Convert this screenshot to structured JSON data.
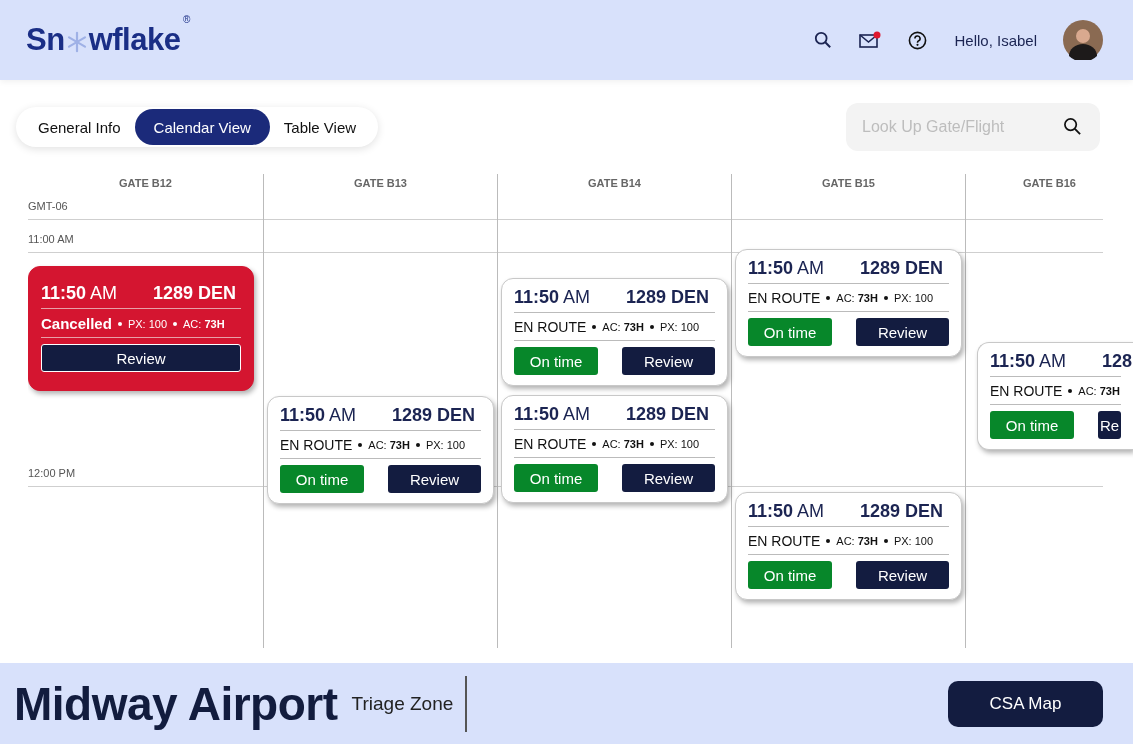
{
  "header": {
    "logo": {
      "before": "Sn",
      "after": "wflake",
      "mark": "®"
    },
    "mail_unread": true,
    "greeting": "Hello, Isabel"
  },
  "tabs": [
    {
      "label": "General Info",
      "selected": false
    },
    {
      "label": "Calendar View",
      "selected": true
    },
    {
      "label": "Table View",
      "selected": false
    }
  ],
  "search": {
    "placeholder": "Look Up Gate/Flight"
  },
  "time_labels": [
    "GMT-06",
    "11:00 AM",
    "12:00 PM"
  ],
  "gates": [
    {
      "label": "GATE B12",
      "cards": [
        {
          "kind": "cancelled",
          "time": "11:50",
          "period": "AM",
          "flight": "1289 DEN",
          "status": "Cancelled",
          "details": [
            "PX: 100",
            "AC: **73H**"
          ],
          "button": "Review"
        }
      ]
    },
    {
      "label": "GATE B13",
      "cards": [
        {
          "kind": "en_route",
          "time": "11:50",
          "period": "AM",
          "flight": "1289 DEN",
          "status": "EN ROUTE",
          "details": [
            "AC: **73H**",
            "PX: 100"
          ],
          "badge": "On time",
          "button": "Review"
        }
      ]
    },
    {
      "label": "GATE B14",
      "cards": [
        {
          "kind": "en_route",
          "time": "11:50",
          "period": "AM",
          "flight": "1289 DEN",
          "status": "EN ROUTE",
          "details": [
            "AC: **73H**",
            "PX: 100"
          ],
          "badge": "On time",
          "button": "Review"
        },
        {
          "kind": "en_route",
          "time": "11:50",
          "period": "AM",
          "flight": "1289 DEN",
          "status": "EN ROUTE",
          "details": [
            "AC: **73H**",
            "PX: 100"
          ],
          "badge": "On time",
          "button": "Review"
        }
      ]
    },
    {
      "label": "GATE B15",
      "cards": [
        {
          "kind": "en_route",
          "time": "11:50",
          "period": "AM",
          "flight": "1289 DEN",
          "status": "EN ROUTE",
          "details": [
            "AC: **73H**",
            "PX: 100"
          ],
          "badge": "On time",
          "button": "Review"
        },
        {
          "kind": "en_route",
          "time": "11:50",
          "period": "AM",
          "flight": "1289 DEN",
          "status": "EN ROUTE",
          "details": [
            "AC: **73H**",
            "PX: 100"
          ],
          "badge": "On time",
          "button": "Review"
        }
      ]
    },
    {
      "label": "GATE B16",
      "cards": [
        {
          "kind": "en_route",
          "time": "11:50",
          "period": "AM",
          "flight": "128",
          "status": "EN ROUTE",
          "details": [
            "AC: **73H**"
          ],
          "badge": "On time",
          "button": "Re"
        }
      ]
    }
  ],
  "footer": {
    "airport": "Midway Airport",
    "zone": "Triage Zone",
    "button": "CSA Map"
  }
}
